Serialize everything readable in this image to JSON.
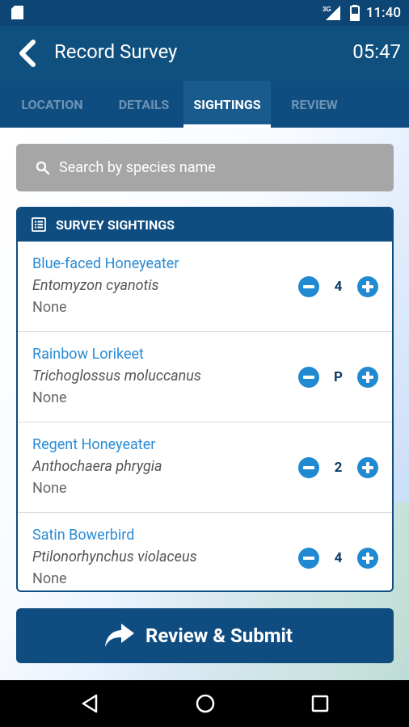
{
  "status_bar": {
    "network": "3G",
    "time": "11:40"
  },
  "app_bar": {
    "title": "Record Survey",
    "timer": "05:47"
  },
  "tabs": [
    {
      "label": "LOCATION",
      "active": false
    },
    {
      "label": "DETAILS",
      "active": false
    },
    {
      "label": "SIGHTINGS",
      "active": true
    },
    {
      "label": "REVIEW",
      "active": false
    }
  ],
  "search": {
    "placeholder": "Search by species name"
  },
  "sightings": {
    "header": "SURVEY SIGHTINGS",
    "items": [
      {
        "common_name": "Blue-faced Honeyeater",
        "scientific_name": "Entomyzon cyanotis",
        "note": "None",
        "count": "4"
      },
      {
        "common_name": "Rainbow Lorikeet",
        "scientific_name": "Trichoglossus moluccanus",
        "note": "None",
        "count": "P"
      },
      {
        "common_name": "Regent Honeyeater",
        "scientific_name": "Anthochaera phrygia",
        "note": "None",
        "count": "2"
      },
      {
        "common_name": "Satin Bowerbird",
        "scientific_name": "Ptilonorhynchus violaceus",
        "note": "None",
        "count": "4"
      }
    ]
  },
  "submit": {
    "label": "Review & Submit"
  },
  "colors": {
    "primary": "#0f4d81",
    "accent": "#1f89d1",
    "link": "#2a8cd6",
    "search_bg": "#a6a6a6"
  },
  "icons": {
    "status": [
      "sd-card-icon",
      "signal-icon",
      "battery-icon"
    ],
    "app_bar": "back-arrow-icon",
    "search": "search-icon",
    "card_header": "list-icon",
    "row_controls": [
      "minus-circle-icon",
      "plus-circle-icon"
    ],
    "submit": "share-arrow-icon",
    "nav": [
      "back-triangle-icon",
      "home-circle-icon",
      "recents-square-icon"
    ]
  }
}
